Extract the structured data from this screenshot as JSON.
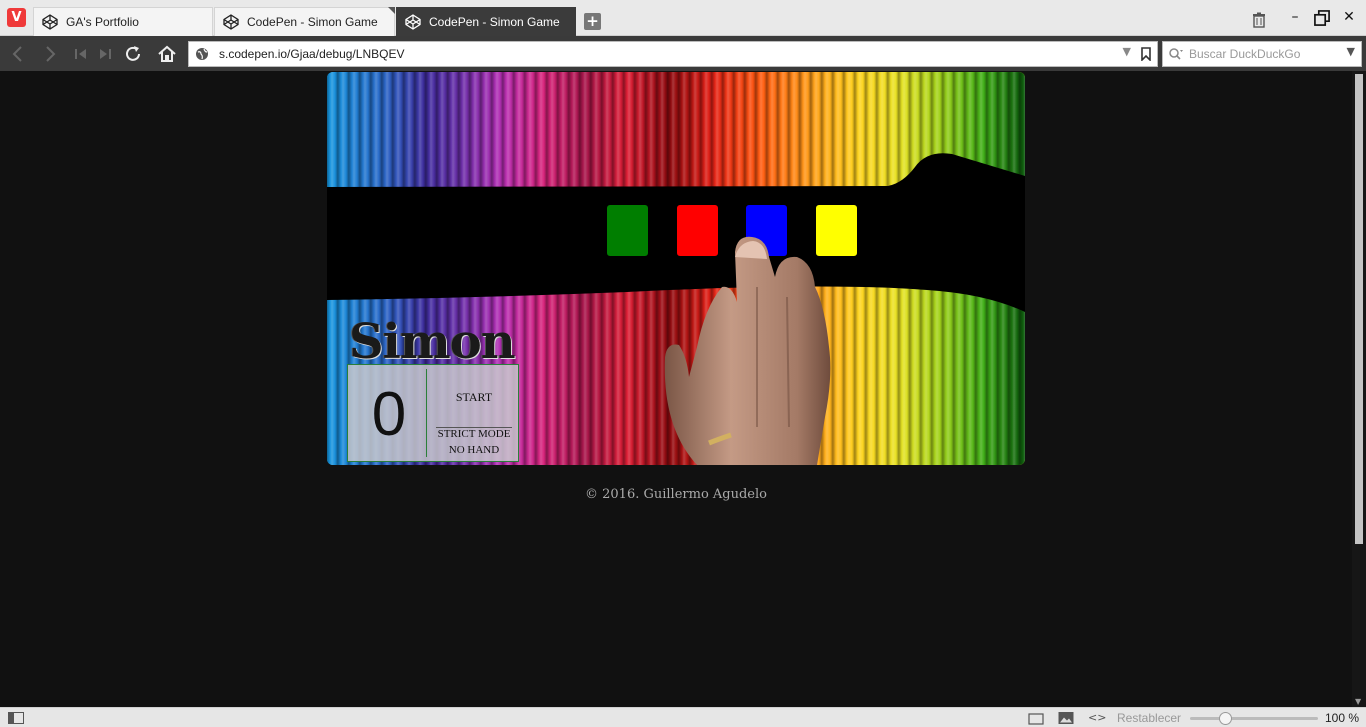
{
  "browser": {
    "tabs": [
      {
        "title": "GA's Portfolio",
        "active": false
      },
      {
        "title": "CodePen - Simon Game",
        "active": false
      },
      {
        "title": "CodePen - Simon Game",
        "active": true
      }
    ],
    "new_tab_label": "+",
    "address": "s.codepen.io/Gjaa/debug/LNBQEV",
    "search_placeholder": "Buscar DuckDuckGo"
  },
  "game": {
    "title": "Simon",
    "count": "0",
    "start_label": "START",
    "strict_label": "STRICT MODE",
    "hand_label": "NO HAND",
    "pads": [
      {
        "name": "green",
        "color": "#007e00"
      },
      {
        "name": "red",
        "color": "#ff0000"
      },
      {
        "name": "blue",
        "color": "#0000ff"
      },
      {
        "name": "yellow",
        "color": "#ffff00"
      }
    ]
  },
  "footer": "© 2016. Guillermo Agudelo",
  "statusbar": {
    "reset_label": "Restablecer",
    "zoom": "100 %"
  }
}
